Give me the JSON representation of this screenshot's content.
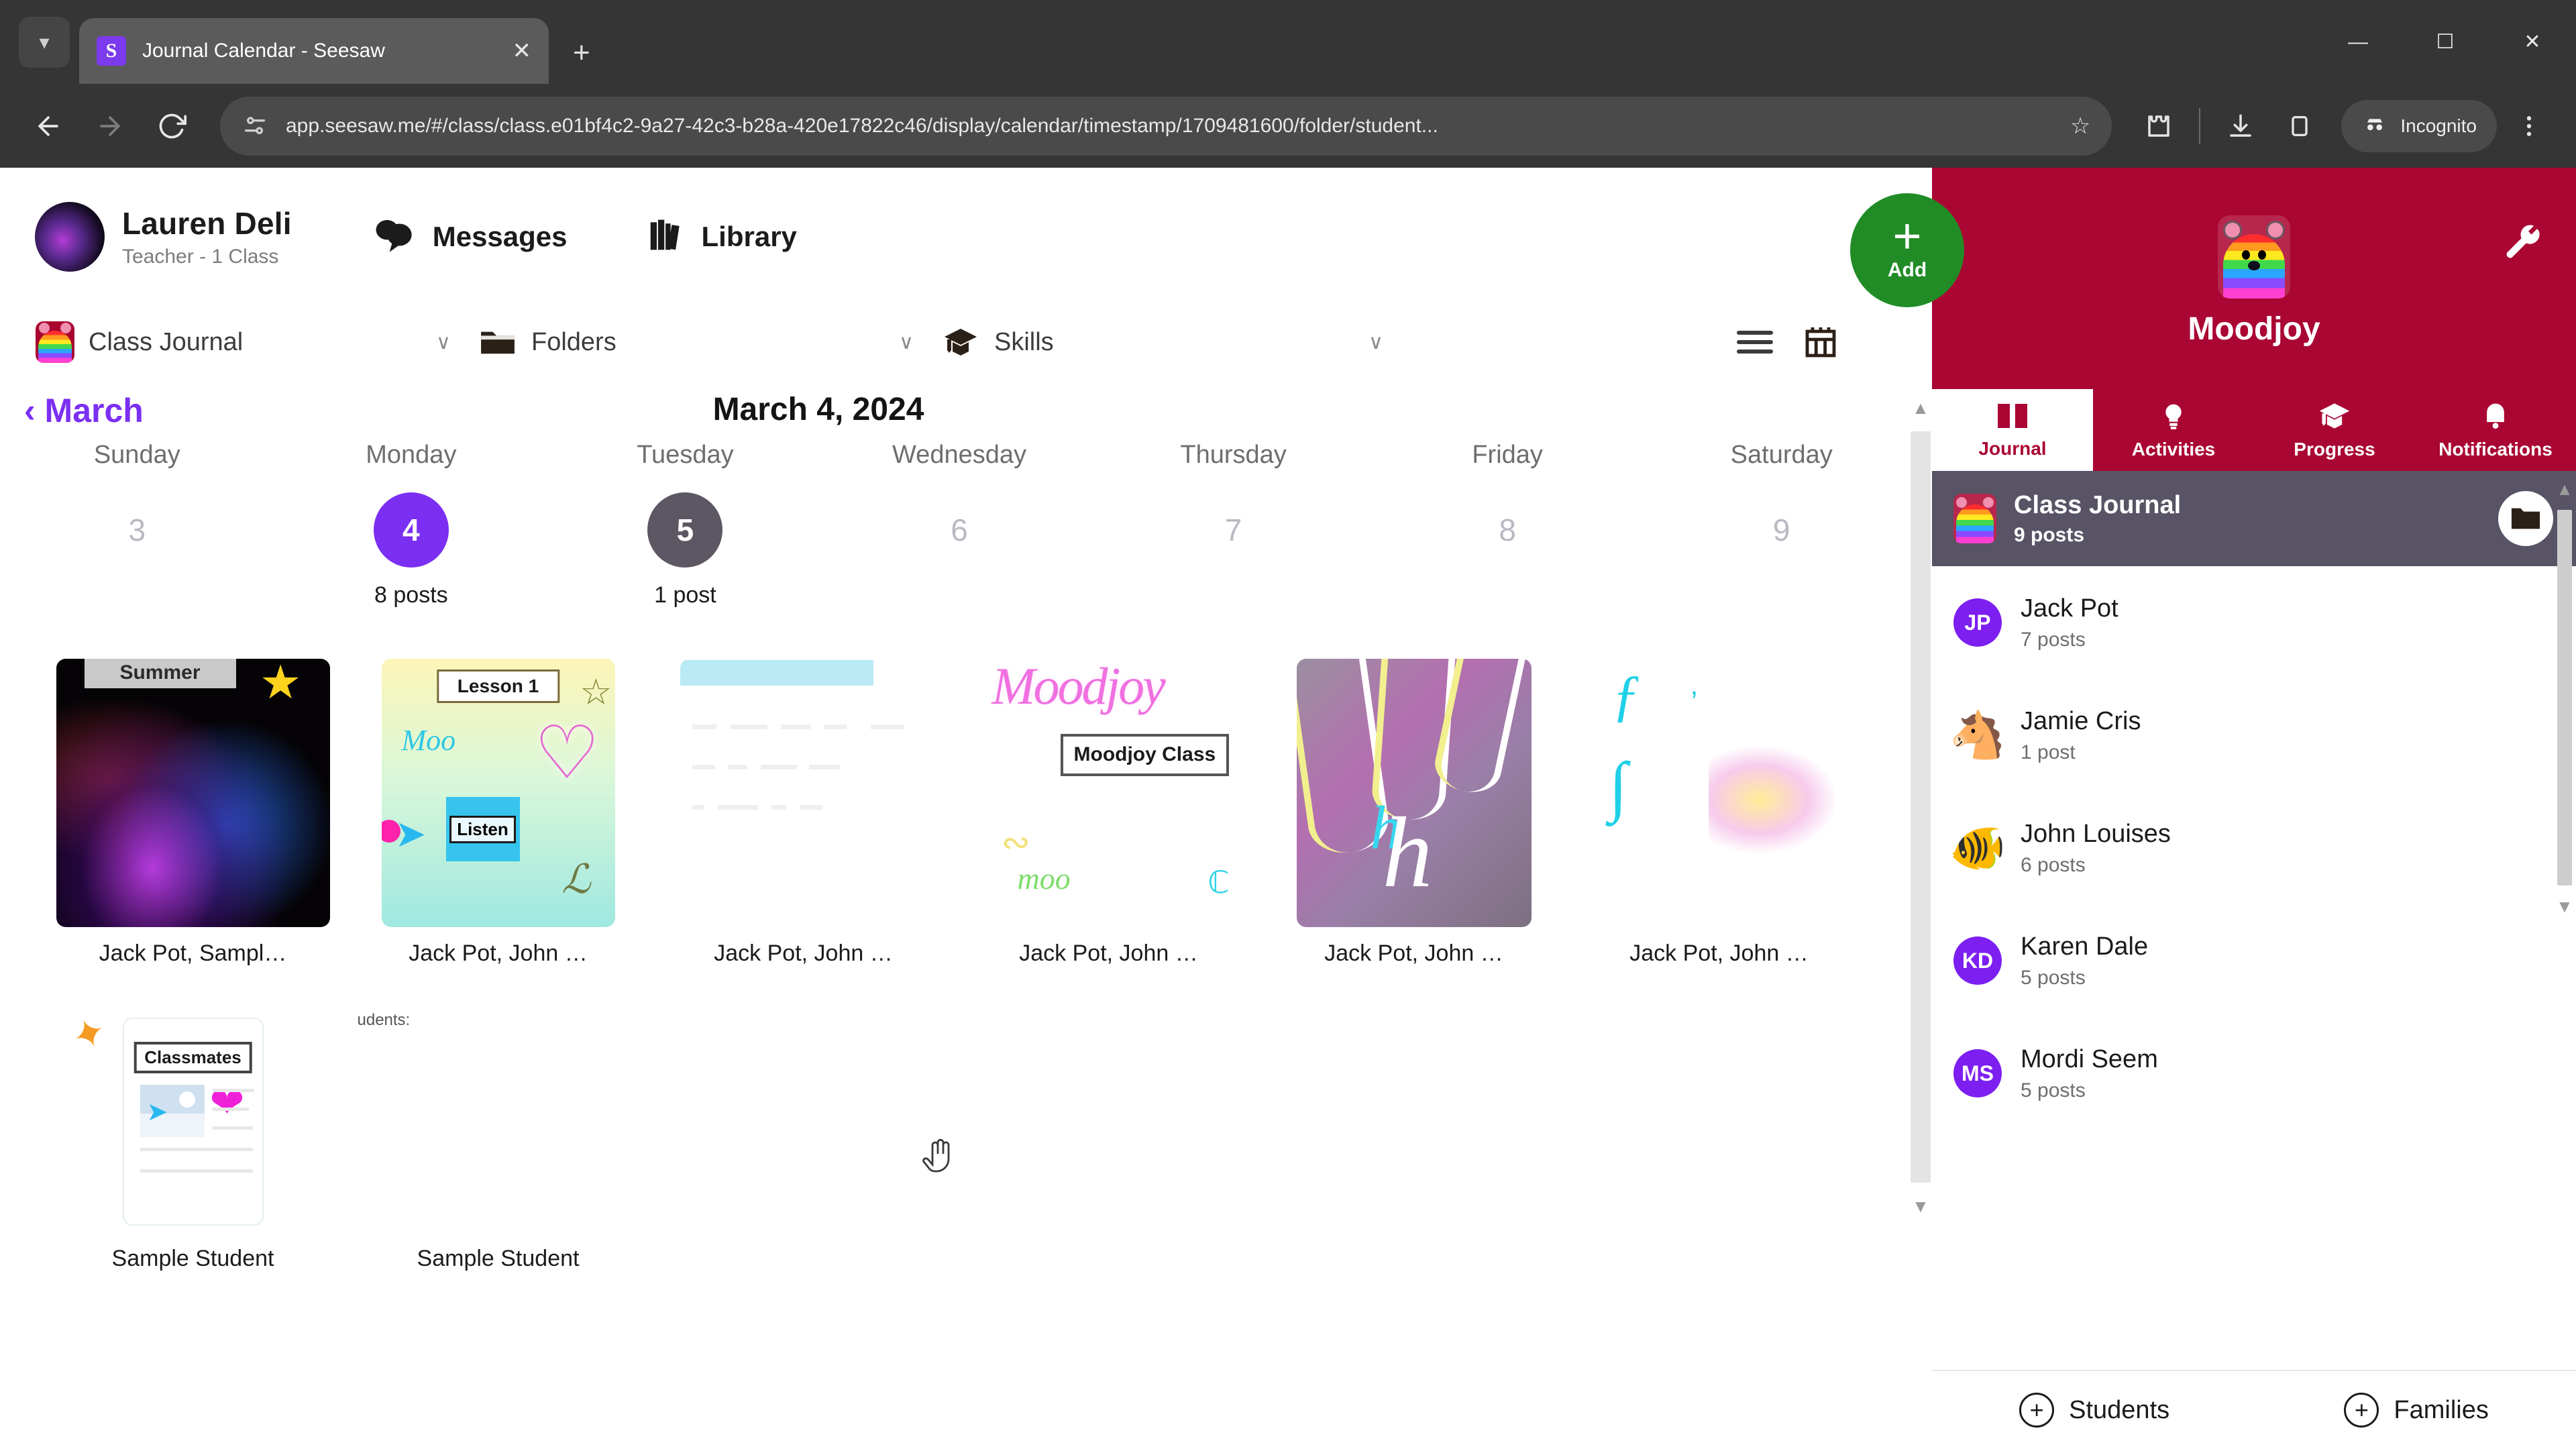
{
  "browser": {
    "tab": {
      "title": "Journal Calendar - Seesaw",
      "favicon_letter": "S",
      "close_icon": "close-icon"
    },
    "new_tab_label": "+",
    "window_controls": {
      "minimize": "—",
      "maximize": "❐",
      "close": "✕"
    },
    "toolbar": {
      "back": "←",
      "forward": "→",
      "reload": "⟳",
      "url": "app.seesaw.me/#/class/class.e01bf4c2-9a27-42c3-b28a-420e17822c46/display/calendar/timestamp/1709481600/folder/student...",
      "star_icon": "bookmark-star-icon",
      "incognito_label": "Incognito",
      "menu_icon": "three-dot-menu-icon"
    }
  },
  "header": {
    "teacher_name": "Lauren Deli",
    "teacher_role": "Teacher - 1 Class",
    "messages_label": "Messages",
    "library_label": "Library"
  },
  "filters": {
    "class_journal": "Class Journal",
    "folders": "Folders",
    "skills": "Skills",
    "chevron": "∨",
    "list_view_icon": "list-view-icon",
    "calendar_view_icon": "calendar-view-icon"
  },
  "calendar": {
    "month_back": "‹ March",
    "current_date": "March 4, 2024",
    "weekdays": [
      "Sunday",
      "Monday",
      "Tuesday",
      "Wednesday",
      "Thursday",
      "Friday",
      "Saturday"
    ],
    "days": [
      {
        "num": "3",
        "posts": "",
        "state": "plain"
      },
      {
        "num": "4",
        "posts": "8 posts",
        "state": "selected"
      },
      {
        "num": "5",
        "posts": "1 post",
        "state": "alt"
      },
      {
        "num": "6",
        "posts": "",
        "state": "plain"
      },
      {
        "num": "7",
        "posts": "",
        "state": "plain"
      },
      {
        "num": "8",
        "posts": "",
        "state": "plain"
      },
      {
        "num": "9",
        "posts": "",
        "state": "plain"
      }
    ]
  },
  "posts": {
    "row1": [
      {
        "caption": "Jack Pot,  Sampl…",
        "label": "Summer",
        "kind": "night-photo"
      },
      {
        "caption": "Jack Pot,  John …",
        "label": "Lesson 1",
        "listen": "Listen",
        "moo": "Moo",
        "kind": "lesson-drawing"
      },
      {
        "caption": "Jack Pot,  John …",
        "kind": "document-mock"
      },
      {
        "caption": "Jack Pot,  John …",
        "label": "Moodjoy Class",
        "title_scribble": "Moodjoy",
        "moo": "moo",
        "kind": "moodjoy-drawing"
      },
      {
        "caption": "Jack Pot,  John …",
        "kind": "neon-photo"
      },
      {
        "caption": "Jack Pot,  John …",
        "kind": "light-drawing"
      }
    ],
    "row2": [
      {
        "caption": "Sample Student",
        "label": "Classmates",
        "kind": "classmates-doc"
      },
      {
        "caption": "Sample Student",
        "fragment": "udents:",
        "kind": "text-fragment"
      }
    ]
  },
  "sidebar": {
    "class_name": "Moodjoy",
    "add_button": {
      "label": "Add",
      "plus": "+"
    },
    "settings_icon": "wrench-icon",
    "tabs": [
      {
        "label": "Journal",
        "icon": "journal-book-icon",
        "active": true
      },
      {
        "label": "Activities",
        "icon": "lightbulb-icon",
        "active": false
      },
      {
        "label": "Progress",
        "icon": "graduation-icon",
        "active": false
      },
      {
        "label": "Notifications",
        "icon": "bell-icon",
        "active": false
      }
    ],
    "class_journal": {
      "title": "Class Journal",
      "posts": "9 posts",
      "folder_icon": "folder-icon"
    },
    "students": [
      {
        "name": "Jack Pot",
        "posts": "7 posts",
        "initials": "JP",
        "emoji": ""
      },
      {
        "name": "Jamie Cris",
        "posts": "1 post",
        "initials": "",
        "emoji": "🐴"
      },
      {
        "name": "John Louises",
        "posts": "6 posts",
        "initials": "",
        "emoji": "🐠"
      },
      {
        "name": "Karen Dale",
        "posts": "5 posts",
        "initials": "KD",
        "emoji": ""
      },
      {
        "name": "Mordi Seem",
        "posts": "5 posts",
        "initials": "MS",
        "emoji": ""
      }
    ],
    "footer": {
      "students_label": "Students",
      "families_label": "Families",
      "plus": "+"
    }
  },
  "colors": {
    "seesaw_red": "#aa0633",
    "seesaw_purple": "#7b2ff2",
    "add_green": "#218c26",
    "selected_day_gray": "#5d5663"
  }
}
